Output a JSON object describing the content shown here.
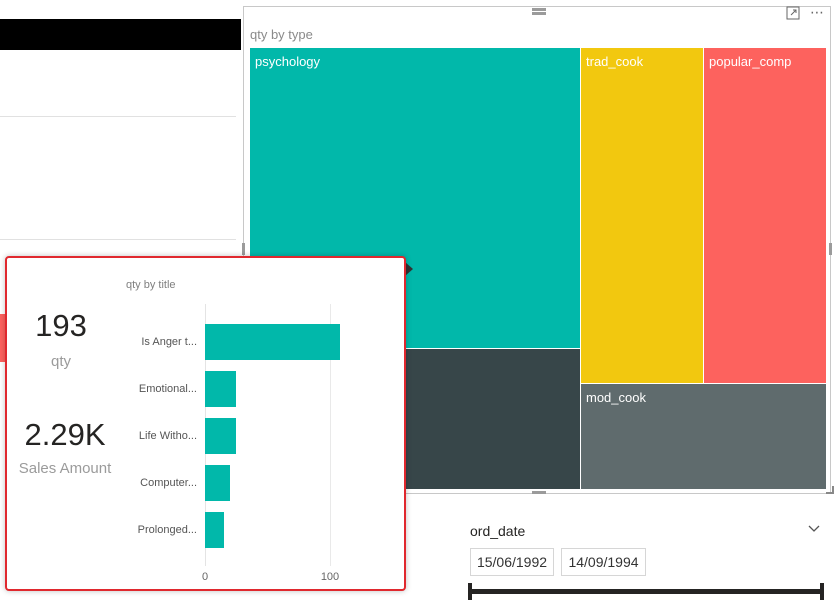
{
  "treemap": {
    "title": "qty by type",
    "tiles": [
      {
        "label": "psychology",
        "color": "#01b8aa"
      },
      {
        "label": "",
        "color": "#374649"
      },
      {
        "label": "trad_cook",
        "color": "#f2c80f"
      },
      {
        "label": "popular_comp",
        "color": "#fd625e"
      },
      {
        "label": "mod_cook",
        "color": "#5f6b6d"
      }
    ]
  },
  "slicer": {
    "label": "ord_date",
    "start_date": "15/06/1992",
    "end_date": "14/09/1994"
  },
  "tooltip": {
    "title": "qty by title",
    "kpis": [
      {
        "value": "193",
        "label": "qty"
      },
      {
        "value": "2.29K",
        "label": "Sales Amount"
      }
    ]
  },
  "chart_data": {
    "type": "bar",
    "orientation": "horizontal",
    "title": "qty by title",
    "categories": [
      "Is Anger t...",
      "Emotional...",
      "Life Witho...",
      "Computer...",
      "Prolonged..."
    ],
    "values": [
      108,
      25,
      25,
      20,
      15
    ],
    "xlim": [
      0,
      130
    ],
    "xticks": [
      0,
      100
    ],
    "color": "#01b8aa"
  },
  "colors": {
    "accent": "#01b8aa",
    "popup_border": "#e0282e"
  }
}
